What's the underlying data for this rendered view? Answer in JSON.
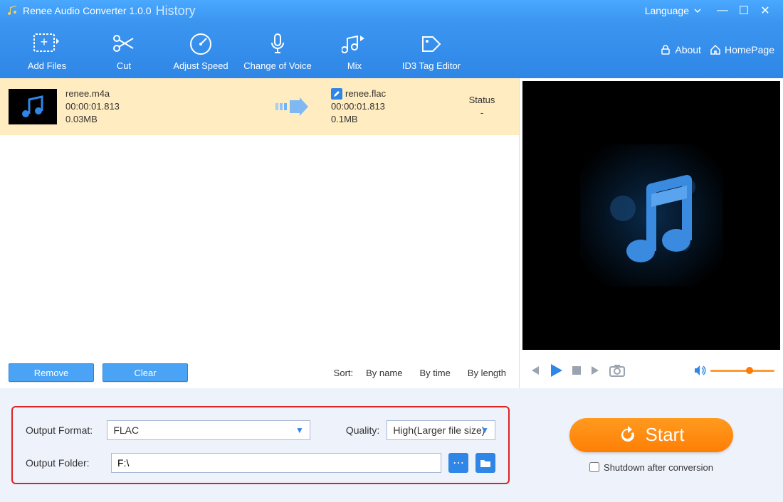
{
  "titlebar": {
    "title": "Renee Audio Converter 1.0.0",
    "history": "History",
    "language": "Language"
  },
  "toolbar": {
    "add_files": "Add Files",
    "cut": "Cut",
    "adjust_speed": "Adjust Speed",
    "change_voice": "Change of Voice",
    "mix": "Mix",
    "id3": "ID3 Tag Editor",
    "about": "About",
    "homepage": "HomePage"
  },
  "file": {
    "in_name": "renee.m4a",
    "in_duration": "00:00:01.813",
    "in_size": "0.03MB",
    "out_name": "renee.flac",
    "out_duration": "00:00:01.813",
    "out_size": "0.1MB",
    "status_header": "Status",
    "status_value": "-"
  },
  "listbottom": {
    "remove": "Remove",
    "clear": "Clear",
    "sort_label": "Sort:",
    "by_name": "By name",
    "by_time": "By time",
    "by_length": "By length"
  },
  "output": {
    "format_label": "Output Format:",
    "format_value": "FLAC",
    "quality_label": "Quality:",
    "quality_value": "High(Larger file size)",
    "folder_label": "Output Folder:",
    "folder_value": "F:\\"
  },
  "start": {
    "label": "Start",
    "shutdown": "Shutdown after conversion"
  }
}
